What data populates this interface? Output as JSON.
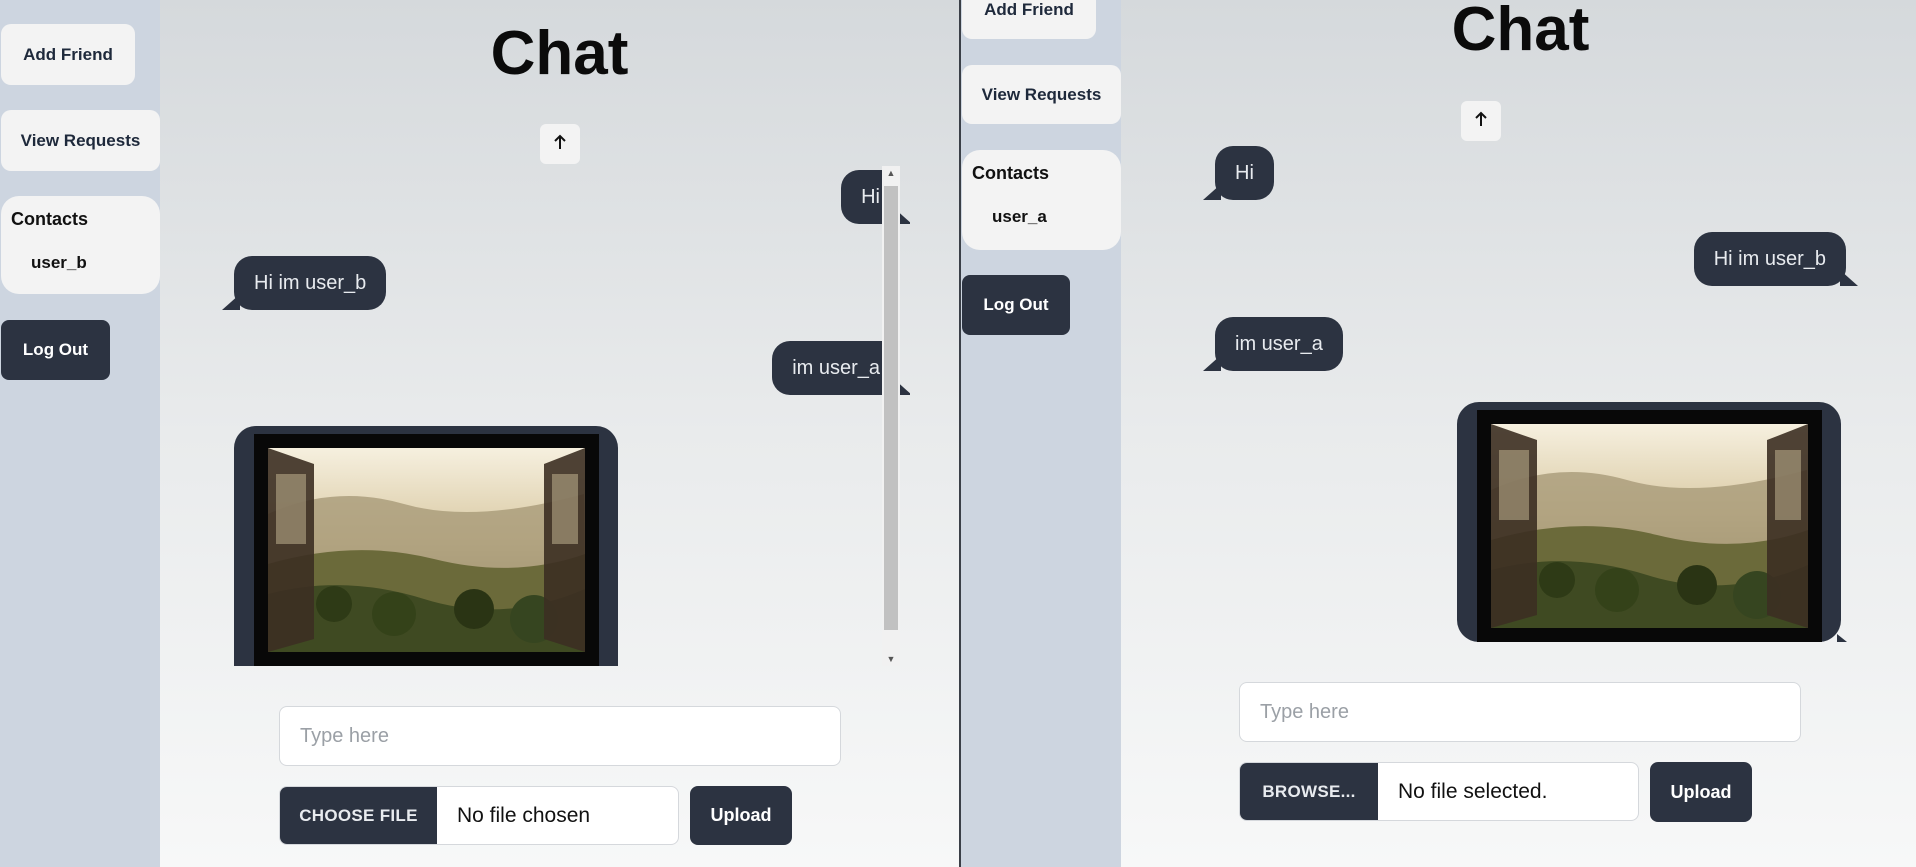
{
  "left_window": {
    "sidebar": {
      "add_friend": "Add Friend",
      "view_requests": "View Requests",
      "contacts_title": "Contacts",
      "contacts": [
        "user_b"
      ],
      "log_out": "Log Out"
    },
    "title": "Chat",
    "messages": [
      {
        "direction": "out",
        "text": "Hi"
      },
      {
        "direction": "in",
        "text": "Hi im user_b"
      },
      {
        "direction": "out",
        "text": "im user_a"
      },
      {
        "direction": "in",
        "type": "image",
        "description_icon": "landscape-window-photo"
      }
    ],
    "input": {
      "placeholder": "Type here",
      "value": ""
    },
    "file": {
      "button": "CHOOSE FILE",
      "status": "No file chosen"
    },
    "upload": "Upload"
  },
  "right_window": {
    "sidebar": {
      "add_friend": "Add Friend",
      "view_requests": "View Requests",
      "contacts_title": "Contacts",
      "contacts": [
        "user_a"
      ],
      "log_out": "Log Out"
    },
    "title": "Chat",
    "messages": [
      {
        "direction": "in",
        "text": "Hi"
      },
      {
        "direction": "out",
        "text": "Hi im user_b"
      },
      {
        "direction": "in",
        "text": "im user_a"
      },
      {
        "direction": "out",
        "type": "image",
        "description_icon": "landscape-window-photo"
      }
    ],
    "input": {
      "placeholder": "Type here",
      "value": ""
    },
    "file": {
      "button": "BROWSE...",
      "status": "No file selected."
    },
    "upload": "Upload"
  },
  "icons": {
    "scroll_up": "arrow-up-icon"
  },
  "colors": {
    "bubble": "#2c3341",
    "sidebar_bg": "#cdd5e0",
    "button_light": "#f3f3f3"
  }
}
